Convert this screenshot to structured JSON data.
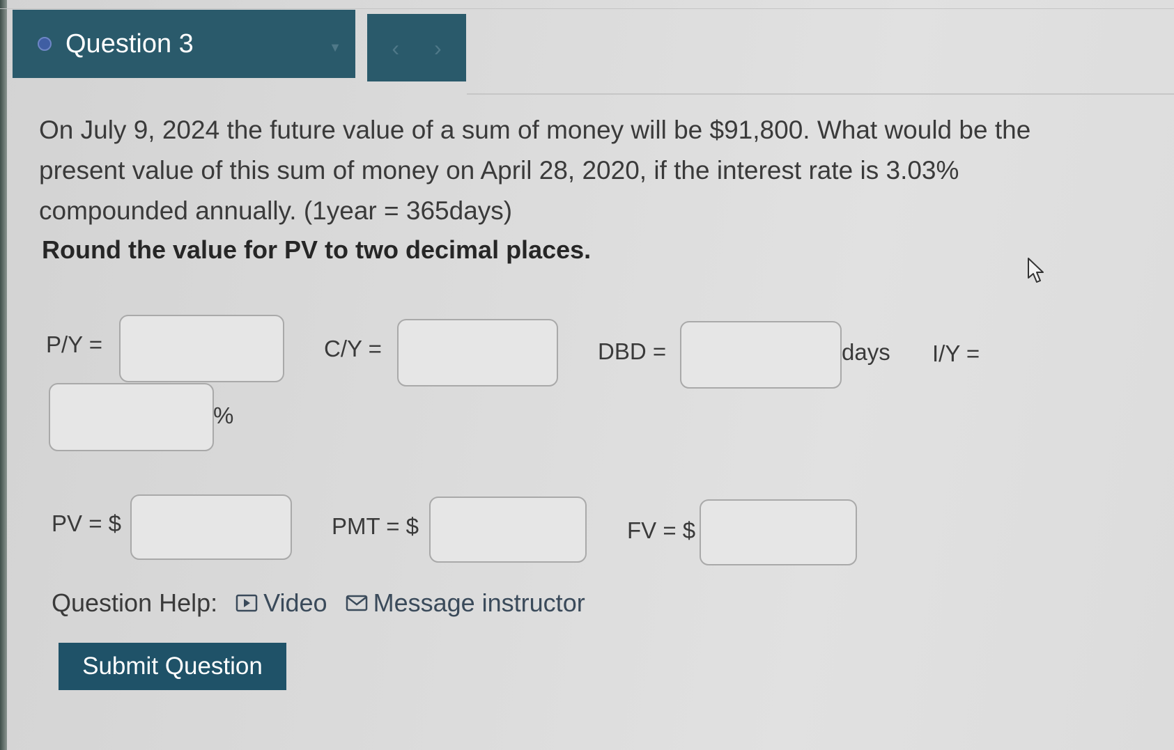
{
  "header": {
    "question_label": "Question 3"
  },
  "question": {
    "text": "On July 9, 2024 the future value of a sum of money will be $91,800. What would be the present value of this sum of money on April 28, 2020, if the interest rate is 3.03% compounded annually. (1year = 365days)",
    "instruction": "Round the value for PV to two decimal places."
  },
  "fields": {
    "py_label": "P/Y =",
    "cy_label": "C/Y =",
    "dbd_label": "DBD =",
    "dbd_unit": "days",
    "iy_label": "I/Y =",
    "iy_unit": "%",
    "pv_label": "PV = $",
    "pmt_label": "PMT = $",
    "fv_label": "FV = $"
  },
  "help": {
    "label": "Question Help:",
    "video": "Video",
    "message": "Message instructor"
  },
  "submit_label": "Submit Question"
}
